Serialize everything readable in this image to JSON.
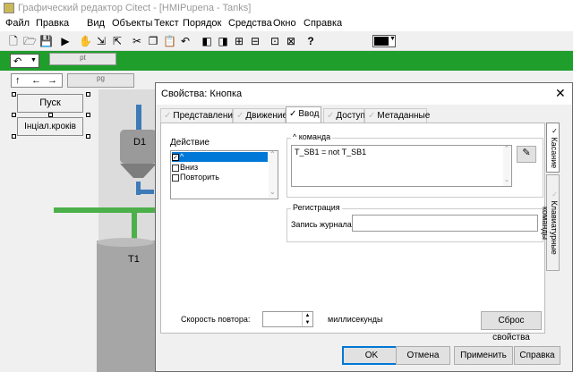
{
  "app": {
    "title": "Графический редактор Citect - [HMIPupena - Tanks]"
  },
  "menu": [
    "Файл",
    "Правка",
    "Вид",
    "Объекты",
    "Текст",
    "Порядок",
    "Средства",
    "Окно",
    "Справка"
  ],
  "toolbar": {
    "color_value": "#000000"
  },
  "pages": {
    "tab1": "pt",
    "tab2": "pg"
  },
  "canvas": {
    "btn1": "Пуск",
    "btn2": "Інціал.кроків",
    "tank_d1": "D1",
    "tank_t1": "T1"
  },
  "dialog": {
    "title": "Свойства: Кнопка",
    "tabs": [
      "Представление",
      "Движение",
      "Ввод",
      "Доступ",
      "Метаданные"
    ],
    "action_label": "Действие",
    "actions": [
      "^",
      "Вниз",
      "Повторить"
    ],
    "command_label": "^ команда",
    "command_text": "T_SB1 = not T_SB1",
    "reg_label": "Регистрация",
    "log_label": "Запись журнала",
    "log_value": "",
    "repeat_label": "Скорость повтора:",
    "repeat_value": "",
    "repeat_unit": "миллисекунды",
    "reset_btn": "Сброс свойства",
    "ok": "OK",
    "cancel": "Отмена",
    "apply": "Применить",
    "help": "Справка",
    "side_tabs": [
      "Касание",
      "Клавиатурные команды"
    ]
  }
}
